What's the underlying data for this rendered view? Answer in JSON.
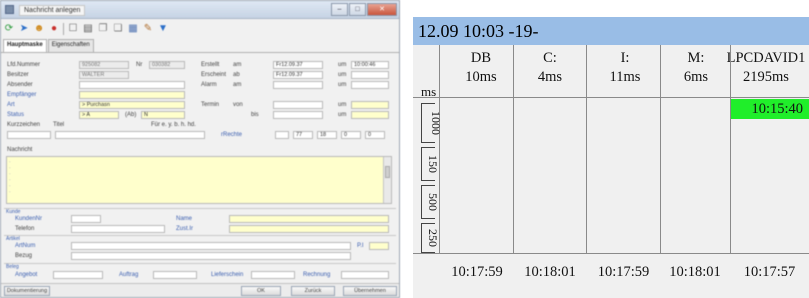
{
  "window": {
    "title": "Nachricht anlegen",
    "tabs": [
      "Hauptmaske",
      "Eigenschaften"
    ]
  },
  "toolbar": {
    "icons": [
      "refresh-icon",
      "forward-icon",
      "user-icon",
      "checkbox-icon",
      "print-icon",
      "copy-icon",
      "paste-icon",
      "document-icon",
      "attachment-icon",
      "filter-icon"
    ]
  },
  "form": {
    "lfd_label": "Lfd.Nummer",
    "lfd_value": "925082",
    "nr_label": "Nr",
    "nr_value": "030382",
    "besitzer_label": "Besitzer",
    "besitzer_value": "WALTER",
    "absender_label": "Absender",
    "empfaenger_label": "Empfänger",
    "art_label": "Art",
    "art_value": "> Purchasn",
    "status_label": "Status",
    "status_value": "> A",
    "status_extra": "(Ab)",
    "status_extra2": "N",
    "kurzzeichen_label": "Kurzzeichen",
    "titel_label": "Titel",
    "titel_hint": "Für  e.  y.  b.  h.  hd.",
    "erstellt_label": "Erstellt",
    "erstellt_am_label": "am",
    "erstellt_date": "Fr12.09.37",
    "erstellt_um_label": "um",
    "erstellt_time": "10:00:46",
    "erscheint_label": "Erscheint",
    "erscheint_ab_label": "ab",
    "erscheint_date": "Fr12.09.37",
    "erscheint_um_label": "um",
    "alarm_label": "Alarm",
    "alarm_am_label": "am",
    "alarm_um_label": "um",
    "termin_label": "Termin",
    "termin_von_label": "von",
    "termin_um_label": "um",
    "bis_label": "bis",
    "bis_um_label": "um",
    "rechte_label": "rRechte",
    "rechte_values": [
      "77",
      "18",
      "0",
      "0"
    ],
    "nachricht_label": "Nachricht"
  },
  "kunde": {
    "section_label": "Kunde",
    "kundennr_label": "KundenNr",
    "name_label": "Name",
    "telefon_label": "Telefon",
    "zustaendig_label": "Zust.Ir"
  },
  "artikel": {
    "section_label": "Artikel",
    "artnr_label": "ArtNum",
    "bezug_label": "Bezug",
    "bezug_right": "P.I"
  },
  "beleg": {
    "section_label": "Beleg",
    "angebot_label": "Angebot",
    "auftrag_label": "Auftrag",
    "lieferschein_label": "Lieferschein",
    "rechnung_label": "Rechnung"
  },
  "statusbar": {
    "left_button": "Dokumentierung",
    "ok": "OK",
    "back": "Zurück",
    "accept": "Übernehmen"
  },
  "monitor": {
    "header": "12.09  10:03  -19-",
    "ms_label": "ms",
    "columns": [
      {
        "name": "DB",
        "value": "10ms",
        "time": "10:17:59"
      },
      {
        "name": "C:",
        "value": "4ms",
        "time": "10:18:01"
      },
      {
        "name": "I:",
        "value": "11ms",
        "time": "10:17:59"
      },
      {
        "name": "M:",
        "value": "6ms",
        "time": "10:18:01"
      },
      {
        "name": "LPCDAVID1",
        "value": "2195ms",
        "time": "10:17:57"
      }
    ],
    "highlight": {
      "column": 4,
      "text": "10:15:40",
      "color": "#20ee2a"
    },
    "scale_labels": [
      "1000",
      "150",
      "500",
      "250"
    ],
    "accent_color": "#99bde6",
    "line_color": "#4a6fd8"
  }
}
